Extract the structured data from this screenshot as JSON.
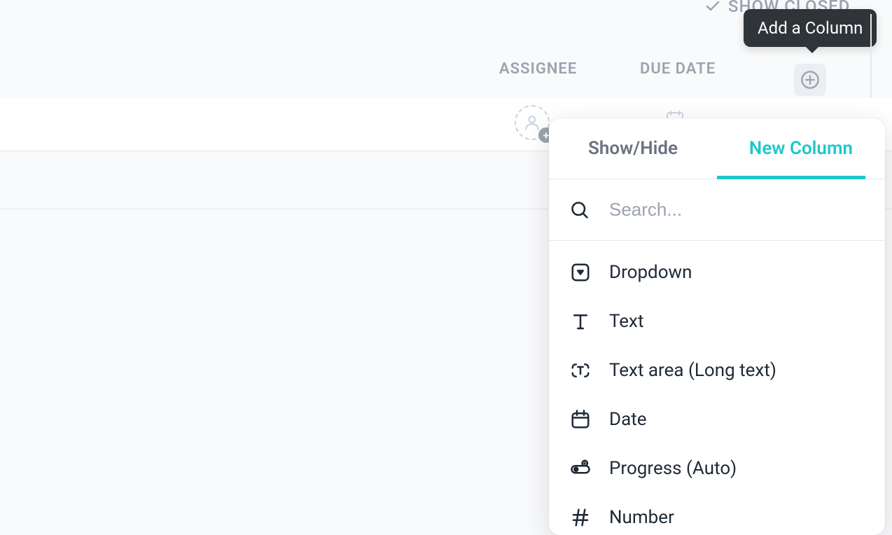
{
  "header": {
    "show_closed_label": "SHOW CLOSED",
    "tooltip_text": "Add a Column"
  },
  "columns": {
    "assignee_label": "ASSIGNEE",
    "duedate_label": "DUE DATE"
  },
  "panel": {
    "tabs": {
      "show_hide": "Show/Hide",
      "new_column": "New Column"
    },
    "search_placeholder": "Search...",
    "types": [
      {
        "label": "Dropdown",
        "icon": "dropdown"
      },
      {
        "label": "Text",
        "icon": "text"
      },
      {
        "label": "Text area (Long text)",
        "icon": "textarea"
      },
      {
        "label": "Date",
        "icon": "date"
      },
      {
        "label": "Progress (Auto)",
        "icon": "progress"
      },
      {
        "label": "Number",
        "icon": "number"
      }
    ]
  }
}
